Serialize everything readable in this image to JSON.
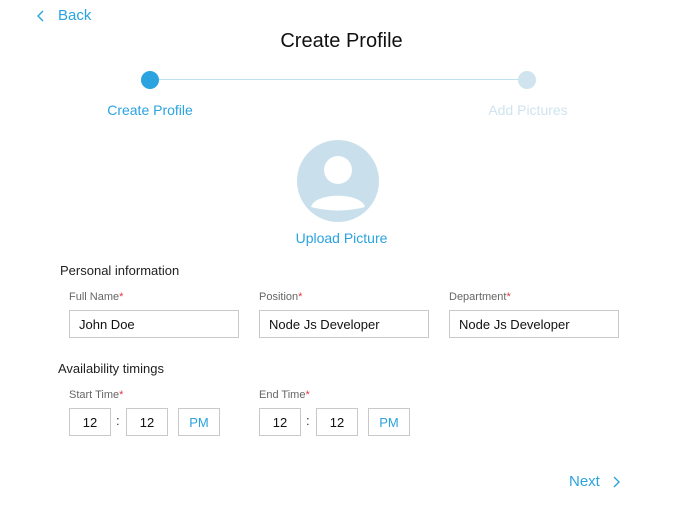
{
  "nav": {
    "back_label": "Back",
    "next_label": "Next"
  },
  "header": {
    "title": "Create Profile"
  },
  "stepper": {
    "steps": [
      {
        "label": "Create Profile"
      },
      {
        "label": "Add Pictures"
      }
    ],
    "active_step": 1
  },
  "avatar": {
    "upload_label": "Upload Picture"
  },
  "personal": {
    "section_title": "Personal information",
    "full_name": {
      "label": "Full Name",
      "value": "John Doe"
    },
    "position": {
      "label": "Position",
      "value": "Node Js Developer"
    },
    "department": {
      "label": "Department",
      "value": "Node Js Developer"
    },
    "required_mark": "*"
  },
  "availability": {
    "section_title": "Availability timings",
    "start": {
      "label": "Start Time",
      "hour": "12",
      "minute": "12",
      "period": "PM"
    },
    "end": {
      "label": "End Time",
      "hour": "12",
      "minute": "12",
      "period": "PM"
    },
    "separator": ":"
  },
  "colors": {
    "accent": "#2aa3e0",
    "inactive": "#cfe4ee",
    "required": "#e0393e"
  },
  "icons": {
    "back": "chevron-left-icon",
    "next": "chevron-right-icon",
    "avatar": "user-silhouette-icon"
  }
}
